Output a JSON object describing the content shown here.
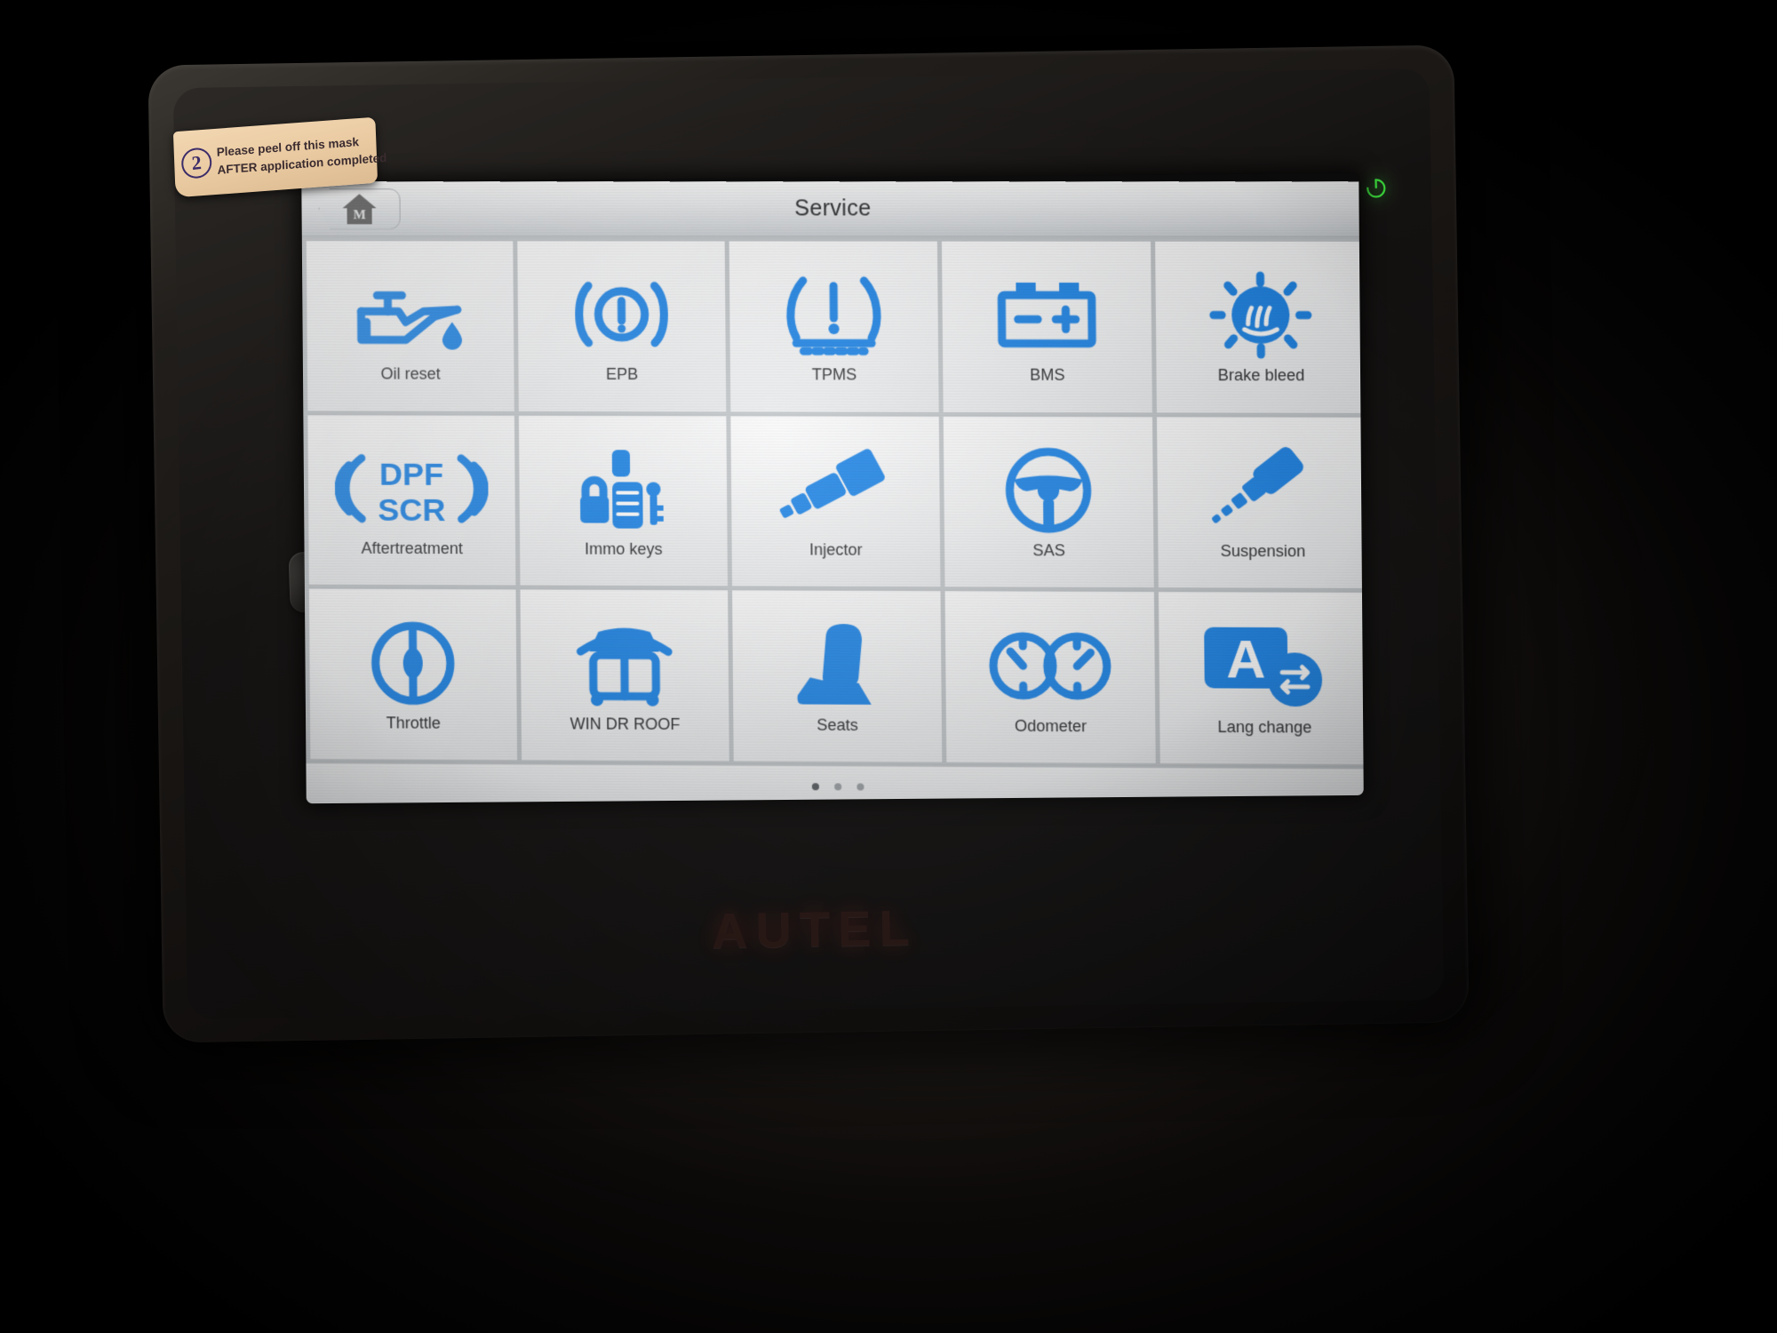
{
  "device": {
    "brand": "AUTEL",
    "power_icon": "power-icon",
    "power_led_color": "#3ad23a"
  },
  "sticker": {
    "number": "2",
    "line1": "Please peel off this mask",
    "line2": "AFTER application completed"
  },
  "header": {
    "home_button": {
      "icon": "home-icon",
      "letter": "M"
    },
    "title": "Service"
  },
  "grid": {
    "tiles": [
      {
        "label": "Oil reset",
        "icon": "oil-can-icon"
      },
      {
        "label": "EPB",
        "icon": "parking-brake-icon"
      },
      {
        "label": "TPMS",
        "icon": "tire-pressure-icon"
      },
      {
        "label": "BMS",
        "icon": "battery-icon"
      },
      {
        "label": "Brake bleed",
        "icon": "brake-bleed-icon"
      },
      {
        "label": "Aftertreatment",
        "icon": "dpf-scr-icon",
        "icon_text_top": "DPF",
        "icon_text_bottom": "SCR"
      },
      {
        "label": "Immo keys",
        "icon": "immo-key-icon"
      },
      {
        "label": "Injector",
        "icon": "injector-icon"
      },
      {
        "label": "SAS",
        "icon": "steering-wheel-icon"
      },
      {
        "label": "Suspension",
        "icon": "shock-absorber-icon"
      },
      {
        "label": "Throttle",
        "icon": "throttle-body-icon"
      },
      {
        "label": "WIN DR ROOF",
        "icon": "car-door-roof-icon"
      },
      {
        "label": "Seats",
        "icon": "seat-icon"
      },
      {
        "label": "Odometer",
        "icon": "odometer-icon"
      },
      {
        "label": "Lang change",
        "icon": "language-change-icon",
        "icon_text": "A"
      }
    ]
  },
  "pagination": {
    "pages": 3,
    "active_page": 1
  },
  "colors": {
    "icon_blue": "#1f86e8",
    "tile_bg": "#f4f5f6",
    "grid_line": "#c3c7ca",
    "label_text": "#303234"
  }
}
